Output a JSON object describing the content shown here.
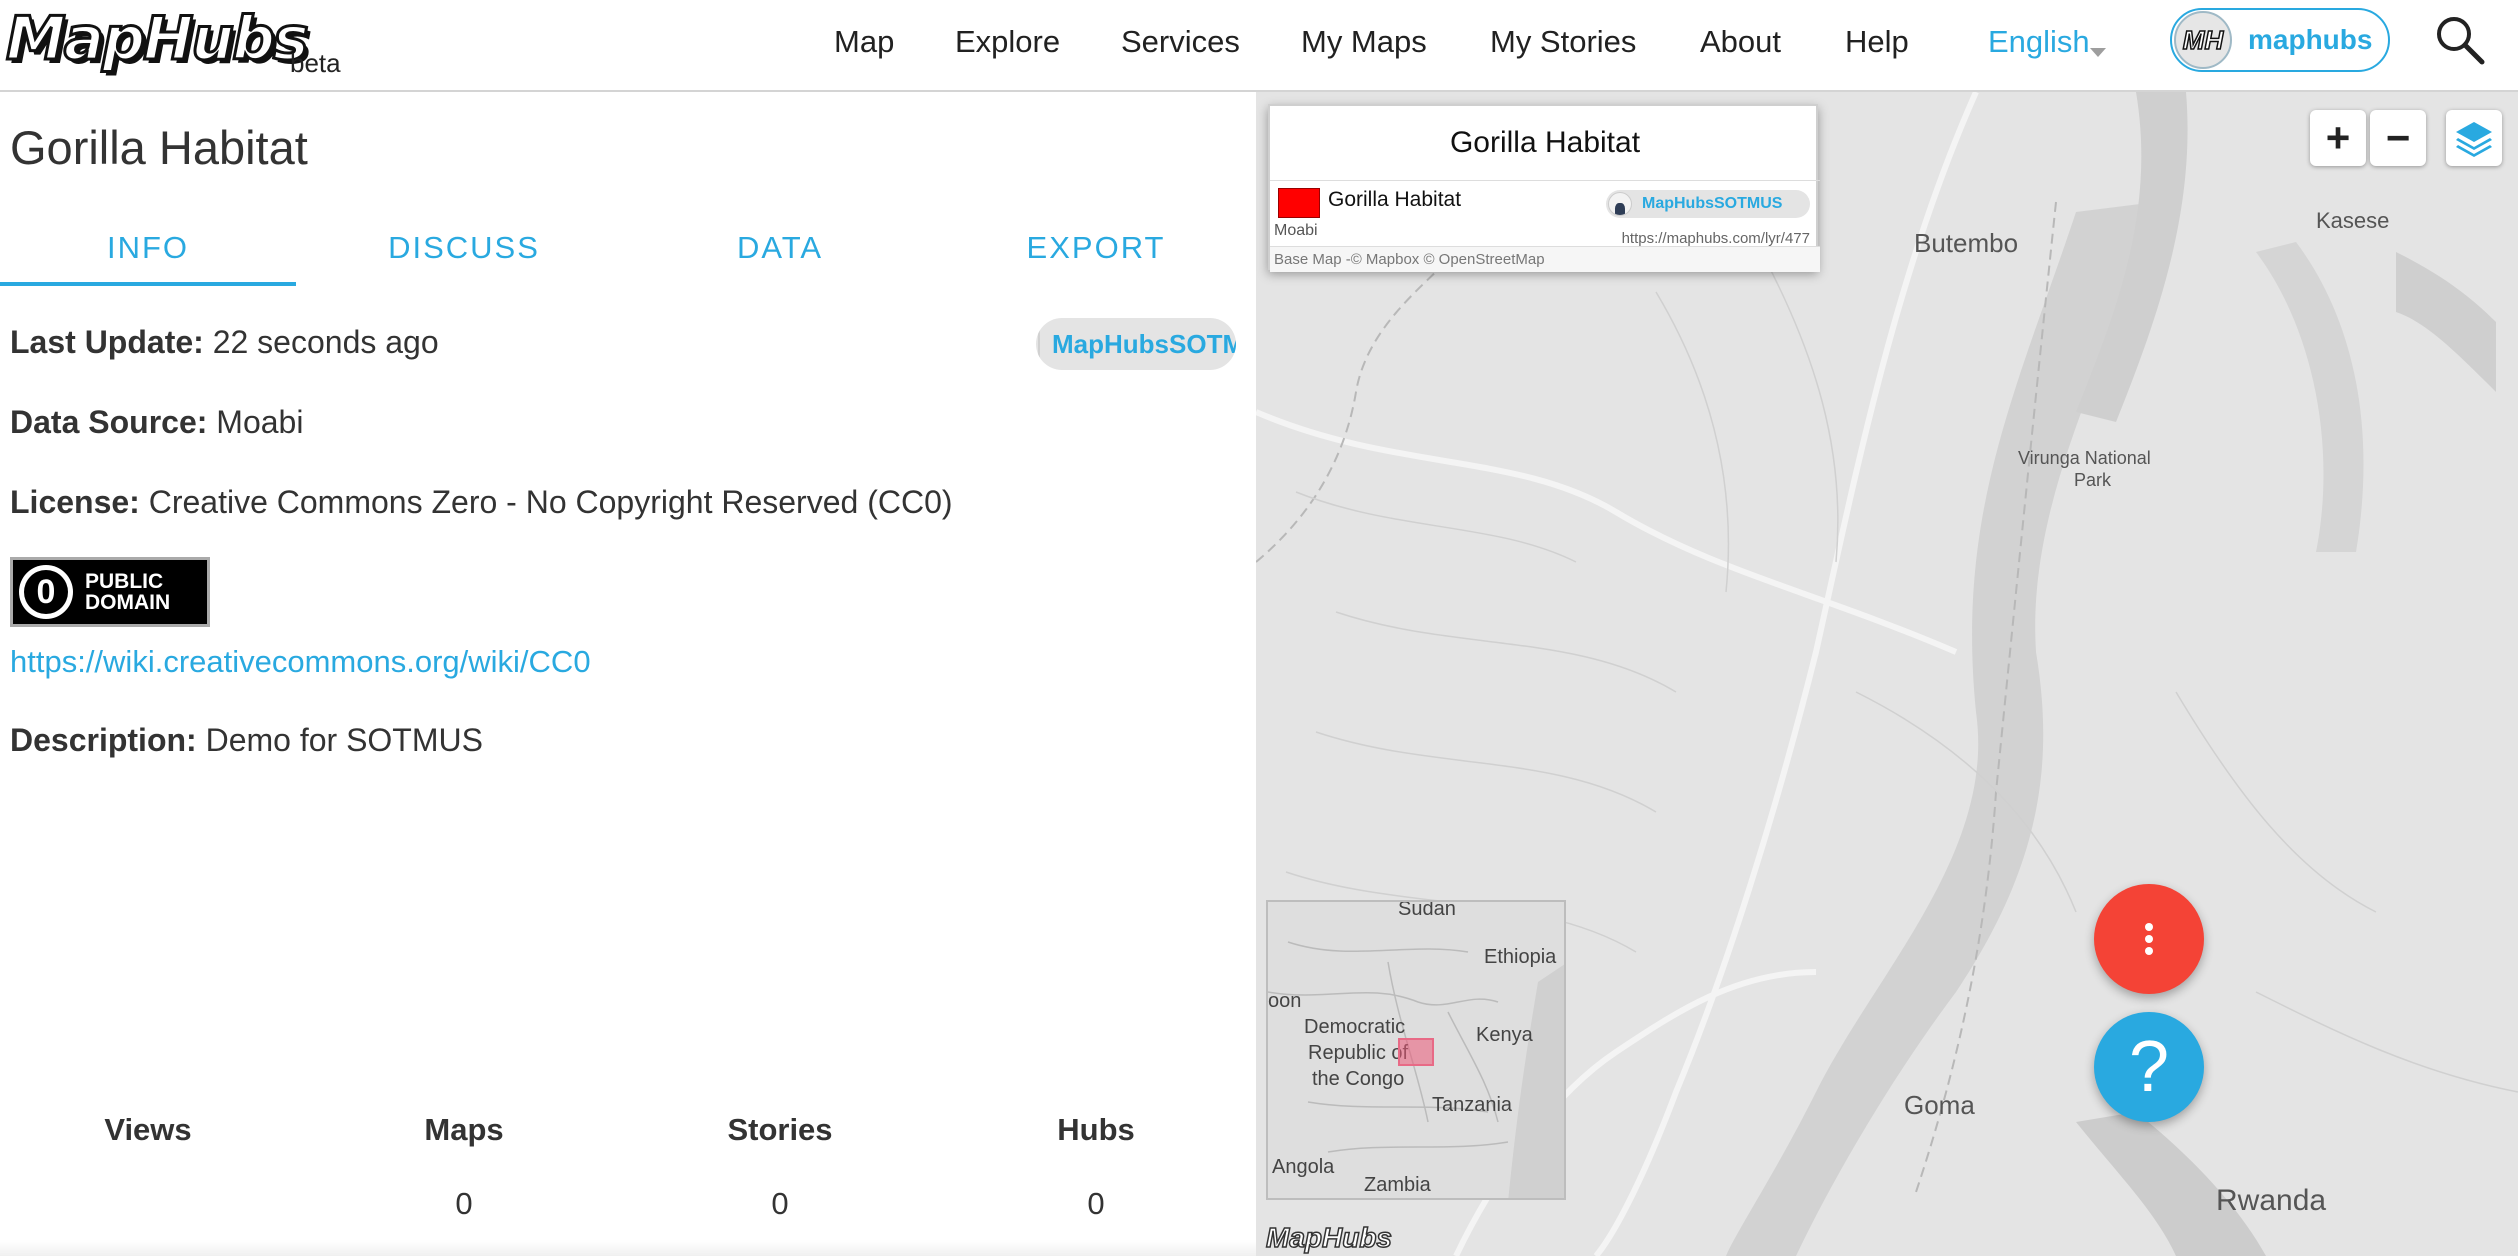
{
  "header": {
    "logo_text": "MapHubs",
    "beta_label": "beta",
    "nav": [
      "Map",
      "Explore",
      "Services",
      "My Maps",
      "My Stories",
      "About",
      "Help"
    ],
    "language": "English",
    "account_initials": "MH",
    "account_name": "maphubs",
    "search_icon": "search-icon"
  },
  "layer": {
    "title": "Gorilla Habitat",
    "tabs": [
      "INFO",
      "DISCUSS",
      "DATA",
      "EXPORT"
    ],
    "active_tab": "INFO",
    "owner": "MapHubsSOTMUS",
    "last_update_label": "Last Update:",
    "last_update_value": "22 seconds ago",
    "data_source_label": "Data Source:",
    "data_source_value": "Moabi",
    "license_label": "License:",
    "license_value": "Creative Commons Zero - No Copyright Reserved (CC0)",
    "license_badge_line1": "PUBLIC",
    "license_badge_line2": "DOMAIN",
    "license_badge_symbol": "0",
    "license_url": "https://wiki.creativecommons.org/wiki/CC0",
    "description_label": "Description:",
    "description_value": "Demo for SOTMUS"
  },
  "stats": {
    "headers": [
      "Views",
      "Maps",
      "Stories",
      "Hubs"
    ],
    "values": [
      "",
      "0",
      "0",
      "0"
    ]
  },
  "map": {
    "legend": {
      "title": "Gorilla Habitat",
      "layer_name": "Gorilla Habitat",
      "swatch_color": "#ff0000",
      "source": "Moabi",
      "owner": "MapHubsSOTMUS",
      "url": "https://maphubs.com/lyr/477",
      "base_map": "Base Map -© Mapbox © OpenStreetMap"
    },
    "controls": {
      "zoom_in": "+",
      "zoom_out": "−"
    },
    "places": {
      "butembo": "Butembo",
      "kasese": "Kasese",
      "virunga_1": "Virunga National",
      "virunga_2": "Park",
      "goma": "Goma",
      "rwanda": "Rwanda"
    },
    "minimap": {
      "sudan": "Sudan",
      "ethiopia": "Ethiopia",
      "oon": "oon",
      "drc_1": "Democratic",
      "drc_2": "Republic of",
      "drc_3": "the Congo",
      "kenya": "Kenya",
      "tanzania": "Tanzania",
      "angola": "Angola",
      "zambia": "Zambia"
    },
    "logo": "MapHubs",
    "help_glyph": "?"
  },
  "colors": {
    "accent": "#29a9e0",
    "fab_red": "#f44336",
    "legend_swatch": "#ff0000"
  }
}
